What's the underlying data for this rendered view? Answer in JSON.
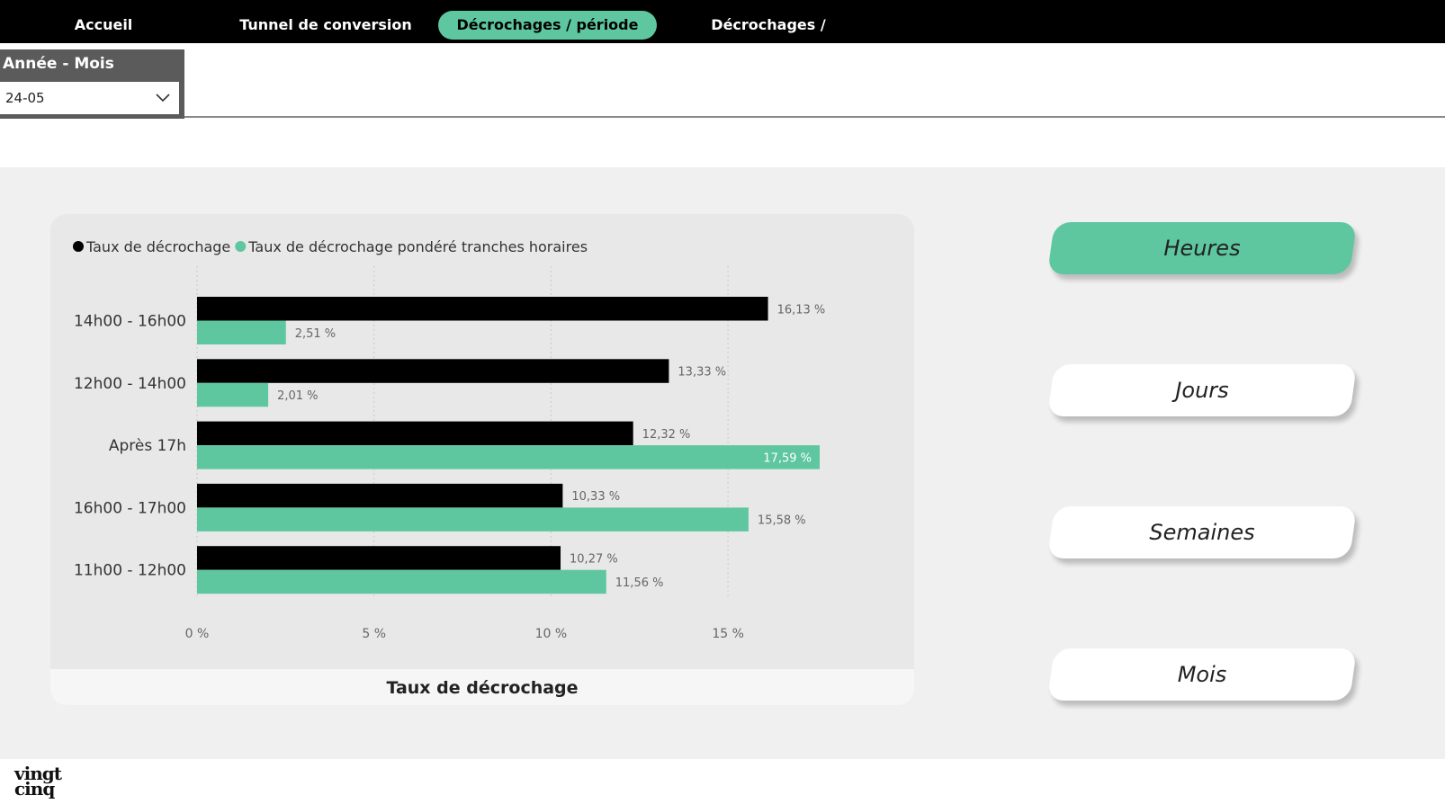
{
  "nav": {
    "items": [
      {
        "label": "Accueil"
      },
      {
        "label": "Tunnel de conversion"
      },
      {
        "label": "Décrochages / période"
      },
      {
        "label": "Décrochages / secteur"
      }
    ],
    "active_index": 2
  },
  "slicer": {
    "title": "Année - Mois",
    "value": "24-05",
    "icon": "chevron-down-icon"
  },
  "chart_card": {
    "footer_title": "Taux de décrochage"
  },
  "chart_data": {
    "type": "bar",
    "orientation": "horizontal",
    "categories": [
      "14h00 - 16h00",
      "12h00 - 14h00",
      "Après 17h",
      "16h00 - 17h00",
      "11h00 - 12h00"
    ],
    "series": [
      {
        "name": "Taux de décrochage",
        "color": "#000000",
        "values": [
          16.13,
          13.33,
          12.32,
          10.33,
          10.27
        ],
        "labels": [
          "16,13 %",
          "13,33 %",
          "12,32 %",
          "10,33 %",
          "10,27 %"
        ]
      },
      {
        "name": "Taux de décrochage pondéré tranches horaires",
        "color": "#5ec7a0",
        "values": [
          2.51,
          2.01,
          17.59,
          15.58,
          11.56
        ],
        "labels": [
          "2,51 %",
          "2,01 %",
          "17,59 %",
          "15,58 %",
          "11,56 %"
        ]
      }
    ],
    "xlim": [
      0,
      17.59
    ],
    "xticks": [
      0,
      5,
      10,
      15
    ],
    "xtick_labels": [
      "0 %",
      "5 %",
      "10 %",
      "15 %"
    ],
    "grid": "vertical dotted",
    "legend": "top-left"
  },
  "side_buttons": [
    {
      "label": "Heures",
      "active": true
    },
    {
      "label": "Jours",
      "active": false
    },
    {
      "label": "Semaines",
      "active": false
    },
    {
      "label": "Mois",
      "active": false
    }
  ],
  "logo": {
    "line1": "vingt",
    "line2": "cinq"
  },
  "colors": {
    "accent": "#5ec7a0",
    "nav_bg": "#000000",
    "page_bg": "#f0f0f0",
    "card_bg": "#e8e8e8"
  }
}
